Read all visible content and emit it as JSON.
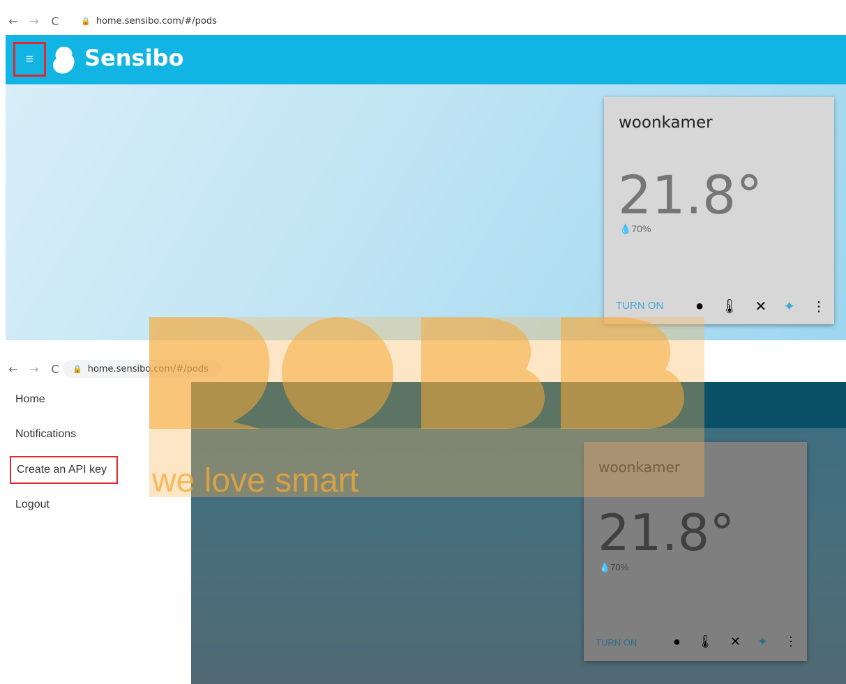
{
  "browser_top": {
    "url": "home.sensibo.com/#/pods",
    "back": "←",
    "forward": "→",
    "reload": "C",
    "lock": "🔒"
  },
  "header": {
    "brand": "Sensibo",
    "menu_glyph": "≡"
  },
  "device": {
    "name": "woonkamer",
    "temperature": "21.8°",
    "humidity": "70%",
    "turn_on": "TURN ON"
  },
  "icon_glyphs": {
    "mode": "●",
    "temp": "🌡",
    "fan": "✕",
    "swing": "✦",
    "more": "⋮"
  },
  "browser_bottom": {
    "url": "home.sensibo.com/#/pods"
  },
  "drawer": {
    "items": [
      "Home",
      "Notifications",
      "Create an API key",
      "Logout"
    ]
  },
  "watermark": {
    "logo_text": "ROBB",
    "tagline": "we love smart",
    "color": "#f7b85c"
  },
  "colors": {
    "sensibo_blue": "#12b4e4",
    "highlight_red": "#e3262d",
    "link_blue": "#3fa9d6"
  }
}
